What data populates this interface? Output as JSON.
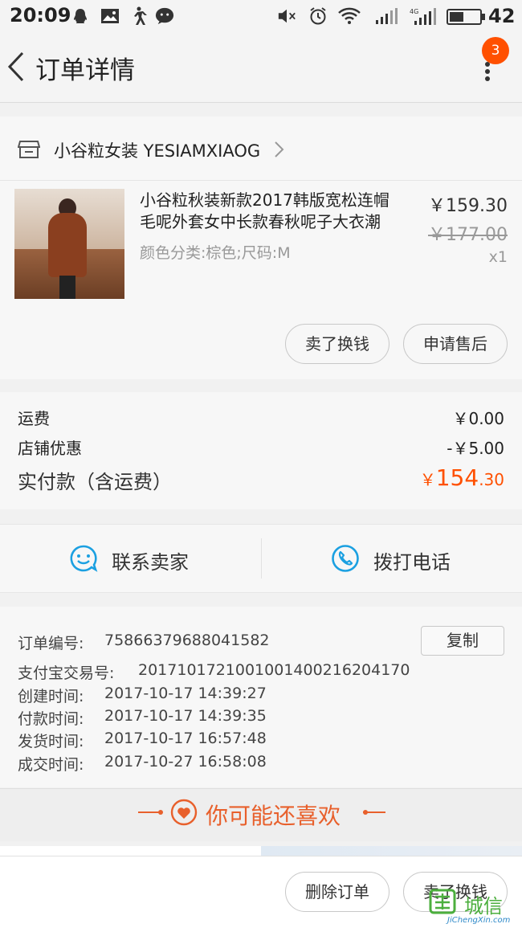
{
  "status_bar": {
    "time": "20:09",
    "battery_percent": "42",
    "network": "4G",
    "icons": [
      "qq-icon",
      "image-icon",
      "walk-icon",
      "chat-icon",
      "mute-icon",
      "alarm-icon",
      "wifi-icon",
      "signal-icon",
      "signal-4g-icon",
      "battery-icon"
    ]
  },
  "header": {
    "title": "订单详情",
    "notification_count": "3"
  },
  "shop": {
    "name": "小谷粒女装 YESIAMXIAOG"
  },
  "product": {
    "title_line1": "小谷粒秋装新款2017韩版宽松连帽",
    "title_line2": "毛呢外套女中长款春秋呢子大衣潮",
    "sku": "颜色分类:棕色;尺码:M",
    "price_now": "￥159.30",
    "price_original": "￥177.00",
    "quantity": "x1"
  },
  "item_actions": {
    "sell_label": "卖了换钱",
    "after_sale_label": "申请售后"
  },
  "totals": {
    "shipping_label": "运费",
    "shipping_value": "￥0.00",
    "discount_label": "店铺优惠",
    "discount_value": "-￥5.00",
    "paid_label": "实付款（含运费）",
    "paid_currency": "￥",
    "paid_integer": "154",
    "paid_decimal": ".30",
    "accent_color": "#ff5000"
  },
  "contact": {
    "seller_label": "联系卖家",
    "phone_label": "拨打电话",
    "icon_color": "#1ba0e1"
  },
  "order_info": {
    "order_no_label": "订单编号:",
    "order_no": "75866379688041582",
    "copy_label": "复制",
    "alipay_label": "支付宝交易号:",
    "alipay_no": "2017101721001001400216204170",
    "created_label": "创建时间:",
    "created": "2017-10-17 14:39:27",
    "paid_label": "付款时间:",
    "paid": "2017-10-17 14:39:35",
    "shipped_label": "发货时间:",
    "shipped": "2017-10-17 16:57:48",
    "closed_label": "成交时间:",
    "closed": "2017-10-27 16:58:08"
  },
  "recommend": {
    "title": "你可能还喜欢",
    "color": "#e8602c"
  },
  "bottom_bar": {
    "delete_label": "删除订单",
    "sell_label": "卖了换钱"
  },
  "watermark": {
    "text": "城信",
    "sub": "JiChengXin.com"
  }
}
